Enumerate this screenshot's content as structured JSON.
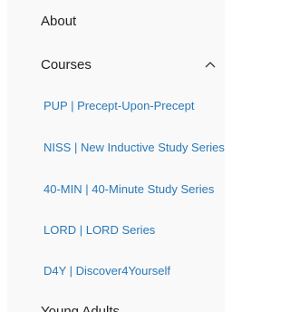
{
  "menu": {
    "about_label": "About",
    "courses_label": "Courses",
    "courses_chevron_icon": "chevron-up-icon",
    "course_items": [
      {
        "label": "PUP | Precept-Upon-Precept"
      },
      {
        "label": "NISS | New Inductive Study Series"
      },
      {
        "label": "40-MIN | 40-Minute Study Series"
      },
      {
        "label": "LORD | LORD Series"
      },
      {
        "label": "D4Y | Discover4Yourself"
      }
    ],
    "young_adults_label": "Young Adults"
  },
  "colors": {
    "panel_background": "#f9f9f9",
    "link_blue": "#2a79b8",
    "text_dark": "#222222"
  }
}
